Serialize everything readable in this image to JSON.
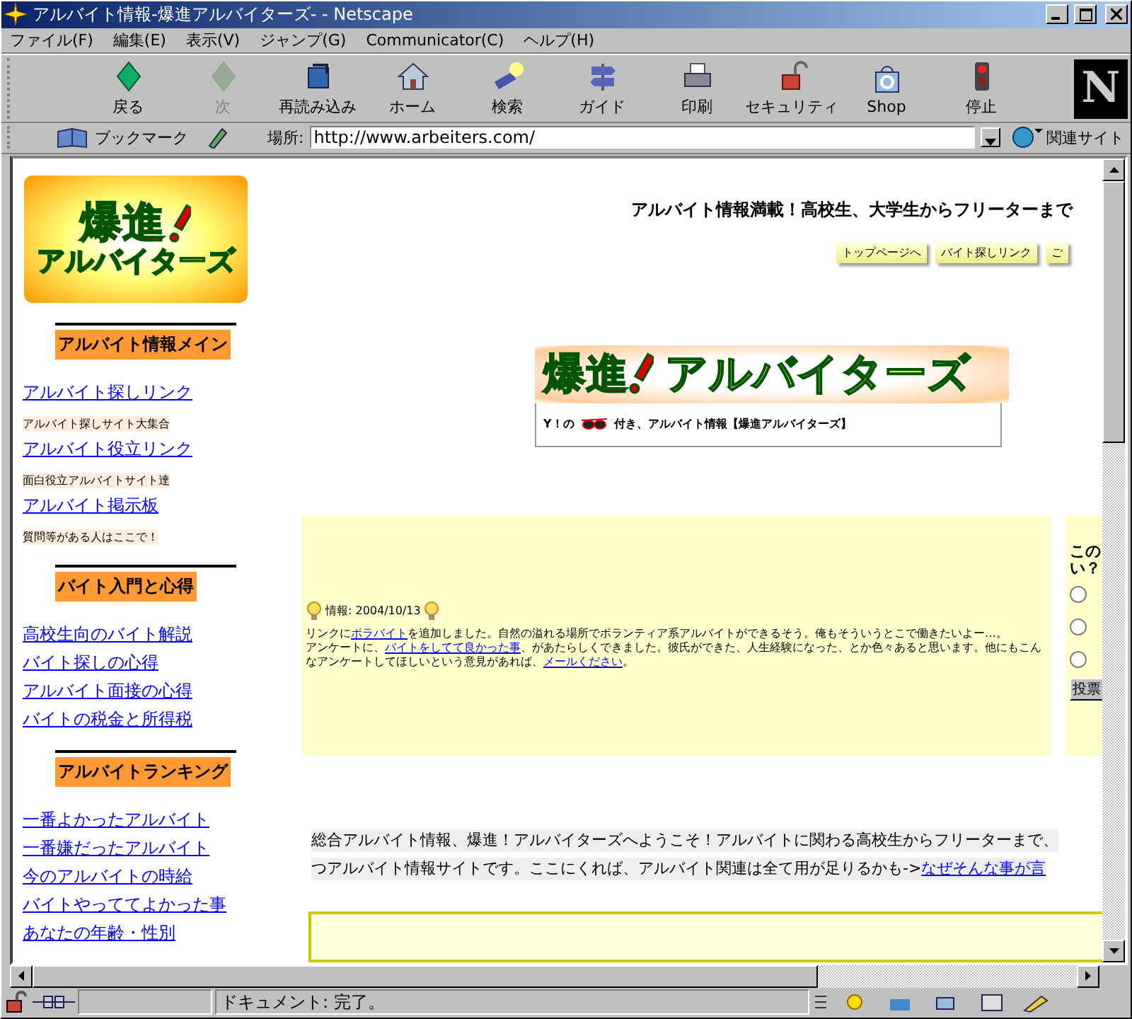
{
  "window": {
    "title": "アルバイト情報-爆進アルバイターズ- - Netscape"
  },
  "menu": [
    "ファイル(F)",
    "編集(E)",
    "表示(V)",
    "ジャンプ(G)",
    "Communicator(C)",
    "ヘルプ(H)"
  ],
  "toolbar": [
    {
      "label": "戻る",
      "kind": "back",
      "disabled": false
    },
    {
      "label": "次",
      "kind": "forward",
      "disabled": true
    },
    {
      "label": "再読み込み",
      "kind": "reload",
      "disabled": false
    },
    {
      "label": "ホーム",
      "kind": "home",
      "disabled": false
    },
    {
      "label": "検索",
      "kind": "search",
      "disabled": false
    },
    {
      "label": "ガイド",
      "kind": "guide",
      "disabled": false
    },
    {
      "label": "印刷",
      "kind": "print",
      "disabled": false
    },
    {
      "label": "セキュリティ",
      "kind": "security",
      "disabled": false
    },
    {
      "label": "Shop",
      "kind": "shop",
      "disabled": false
    },
    {
      "label": "停止",
      "kind": "stop",
      "disabled": false
    }
  ],
  "brand": "N",
  "location_bar": {
    "bookmarks": "ブックマーク",
    "label": "場所:",
    "url": "http://www.arbeiters.com/",
    "related": "関連サイト"
  },
  "page": {
    "logo": {
      "line1": "爆進",
      "line2": "アルバイターズ"
    },
    "sidebar": [
      {
        "heading": "アルバイト情報メイン",
        "items": [
          {
            "kind": "link",
            "text": "アルバイト探しリンク"
          },
          {
            "kind": "note",
            "text": "アルバイト探しサイト大集合"
          },
          {
            "kind": "link",
            "text": "アルバイト役立リンク"
          },
          {
            "kind": "note",
            "text": "面白役立アルバイトサイト達"
          },
          {
            "kind": "link",
            "text": "アルバイト掲示板"
          },
          {
            "kind": "note",
            "text": "質問等がある人はここで！"
          }
        ]
      },
      {
        "heading": "バイト入門と心得",
        "items": [
          {
            "kind": "link",
            "text": "高校生向のバイト解説"
          },
          {
            "kind": "link",
            "text": "バイト探しの心得"
          },
          {
            "kind": "link",
            "text": "アルバイト面接の心得"
          },
          {
            "kind": "link",
            "text": "バイトの税金と所得税"
          }
        ]
      },
      {
        "heading": "アルバイトランキング",
        "items": [
          {
            "kind": "link",
            "text": "一番よかったアルバイト"
          },
          {
            "kind": "link",
            "text": "一番嫌だったアルバイト"
          },
          {
            "kind": "link",
            "text": "今のアルバイトの時給"
          },
          {
            "kind": "link",
            "text": "バイトやっててよかった事"
          },
          {
            "kind": "link",
            "text": "あなたの年齢・性別"
          }
        ]
      }
    ],
    "headline": "アルバイト情報満載！高校生、大学生からフリーターまで",
    "nav_buttons": [
      "トップページへ",
      "バイト探しリンク",
      "ご"
    ],
    "banner": {
      "line1": "爆進",
      "line2": "アルバイターズ"
    },
    "caption": {
      "before": "Y！の",
      "after": "付き、アルバイト情報【爆進アルバイターズ】"
    },
    "news": {
      "label": "情報: 2004/10/13",
      "paragraphs": [
        [
          {
            "kind": "text",
            "text": "リンクに"
          },
          {
            "kind": "link",
            "text": "ボラバイト"
          },
          {
            "kind": "text",
            "text": "を追加しました。自然の溢れる場所でボランティア系アルバイトができるそう。俺もそういうとこで働きたいよー…。"
          }
        ],
        [
          {
            "kind": "text",
            "text": "アンケートに、"
          },
          {
            "kind": "link",
            "text": "バイトをしてて良かった事"
          },
          {
            "kind": "text",
            "text": "、があたらしくできました。彼氏ができた、人生経験になった、とか色々あると思います。他にもこんなアンケートしてほしいという意見があれば、"
          },
          {
            "kind": "link",
            "text": "メールください"
          },
          {
            "kind": "text",
            "text": "。"
          }
        ]
      ]
    },
    "poll": {
      "question": [
        "この",
        "い？"
      ],
      "options": [
        {
          "selected": false
        },
        {
          "selected": false
        },
        {
          "selected": false
        }
      ],
      "button": "投票"
    },
    "welcome": [
      [
        {
          "kind": "text",
          "text": "総合アルバイト情報、爆進！アルバイターズへようこそ！アルバイトに関わる高校生からフリーターまで、"
        }
      ],
      [
        {
          "kind": "text",
          "text": "つアルバイト情報サイトです。ここにくれば、アルバイト関連は全て用が足りるかも->"
        },
        {
          "kind": "link",
          "text": "なぜそんな事が言"
        }
      ]
    ]
  },
  "status_bar": {
    "text": "ドキュメント: 完了。"
  }
}
